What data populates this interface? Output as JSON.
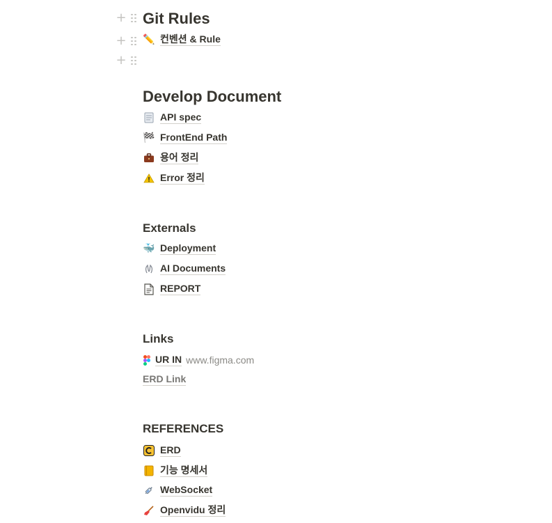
{
  "git_rules": {
    "title": "Git Rules",
    "items": [
      {
        "icon": "pencil-icon",
        "label": "컨벤션 & Rule"
      }
    ]
  },
  "develop_document": {
    "title": "Develop Document",
    "items": [
      {
        "icon": "page-icon",
        "label": "API spec"
      },
      {
        "icon": "checkered-flag-icon",
        "label": "FrontEnd Path"
      },
      {
        "icon": "briefcase-icon",
        "label": "용어 정리"
      },
      {
        "icon": "warning-icon",
        "label": "Error 정리"
      }
    ]
  },
  "externals": {
    "title": "Externals",
    "items": [
      {
        "icon": "whale-icon",
        "label": "Deployment"
      },
      {
        "icon": "ai-icon",
        "label": "AI Documents"
      },
      {
        "icon": "document-icon",
        "label": "REPORT"
      }
    ]
  },
  "links": {
    "title": "Links",
    "figma": {
      "icon": "figma-icon",
      "label": "UR IN",
      "domain": "www.figma.com"
    },
    "erd_link": "ERD Link"
  },
  "references": {
    "title": "REFERENCES",
    "items": [
      {
        "icon": "erd-icon",
        "label": "ERD"
      },
      {
        "icon": "notebook-icon",
        "label": "기능 명세서"
      },
      {
        "icon": "syringe-icon",
        "label": "WebSocket"
      },
      {
        "icon": "broom-icon",
        "label": "Openvidu 정리"
      }
    ]
  }
}
